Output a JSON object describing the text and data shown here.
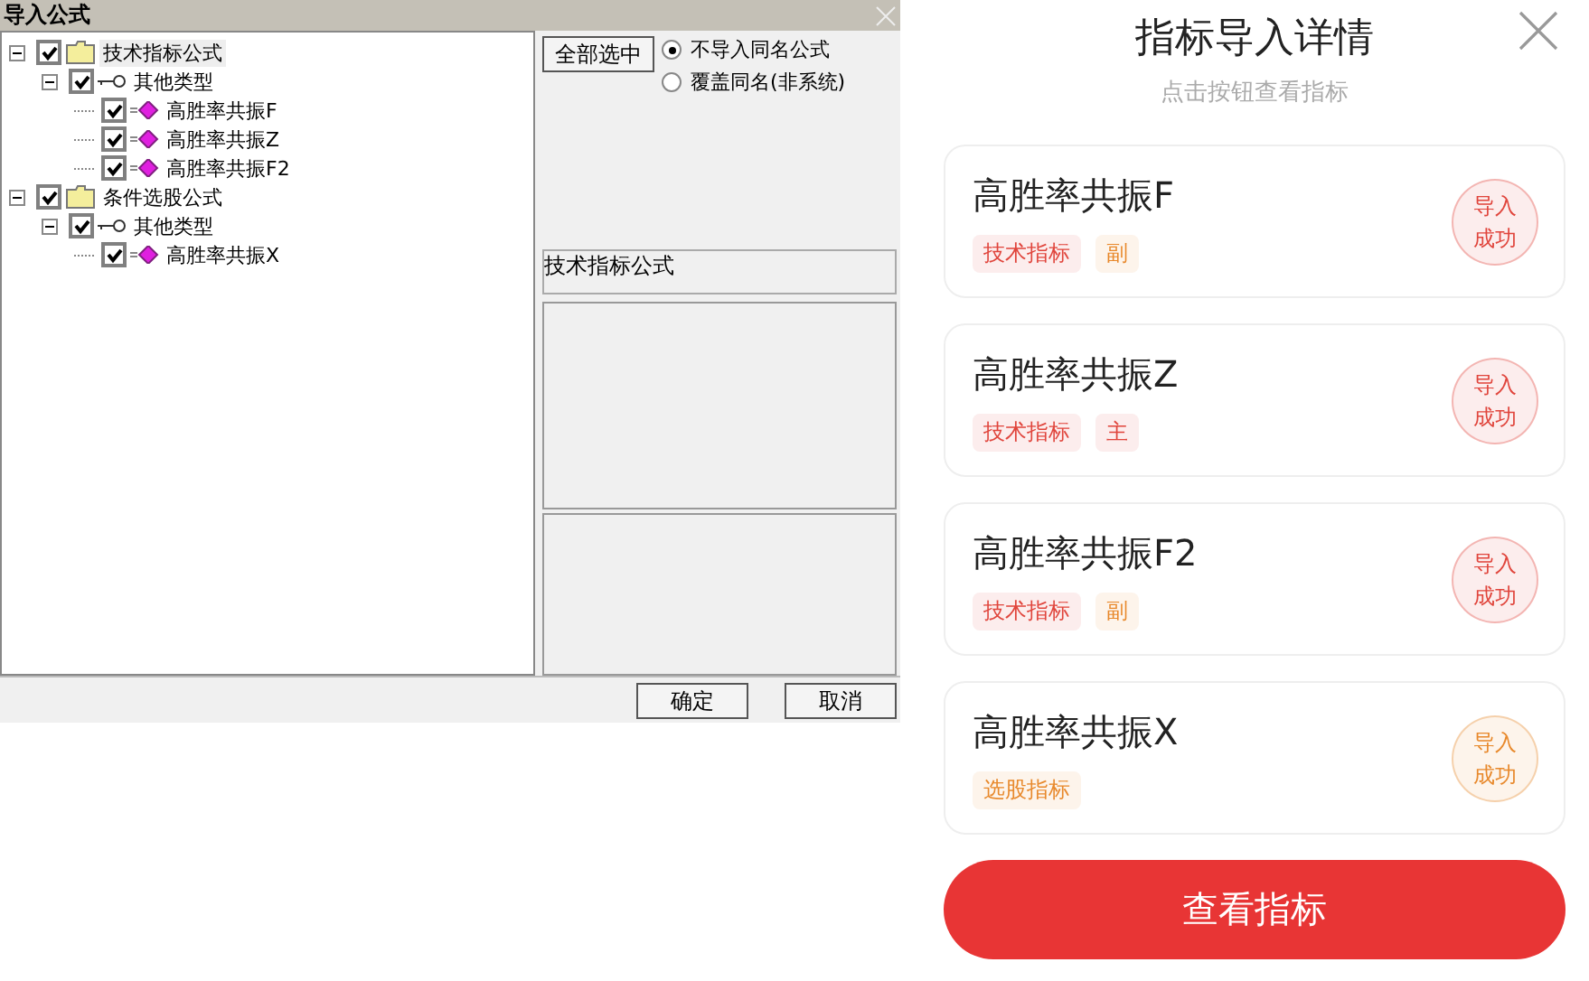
{
  "dialog": {
    "title": "导入公式",
    "tree": [
      {
        "kind": "folder",
        "label": "技术指标公式",
        "checked": true,
        "expanded": true,
        "selected": true,
        "children": [
          {
            "kind": "key",
            "label": "其他类型",
            "checked": true,
            "expanded": true,
            "selected": false,
            "children": [
              {
                "kind": "formula",
                "label": "高胜率共振F",
                "checked": true,
                "selected": false
              },
              {
                "kind": "formula",
                "label": "高胜率共振Z",
                "checked": true,
                "selected": false
              },
              {
                "kind": "formula",
                "label": "高胜率共振F2",
                "checked": true,
                "selected": false
              }
            ]
          }
        ]
      },
      {
        "kind": "folder",
        "label": "条件选股公式",
        "checked": true,
        "expanded": true,
        "selected": false,
        "children": [
          {
            "kind": "key",
            "label": "其他类型",
            "checked": true,
            "expanded": true,
            "selected": false,
            "children": [
              {
                "kind": "formula",
                "label": "高胜率共振X",
                "checked": true,
                "selected": false
              }
            ]
          }
        ]
      }
    ],
    "select_all_button": "全部选中",
    "radios": [
      {
        "label": "不导入同名公式",
        "selected": true
      },
      {
        "label": "覆盖同名(非系统)",
        "selected": false
      }
    ],
    "category_field": "技术指标公式",
    "buttons": [
      "确定",
      "取消"
    ]
  },
  "panel": {
    "title": "指标导入详情",
    "subtitle": "点击按钮查看指标",
    "items": [
      {
        "name": "高胜率共振F",
        "tags": [
          {
            "label": "技术指标",
            "color": "#e0453c"
          },
          {
            "label": "副",
            "color": "#e8892c"
          }
        ],
        "status": "导入成功",
        "color": "#e0453c"
      },
      {
        "name": "高胜率共振Z",
        "tags": [
          {
            "label": "技术指标",
            "color": "#e0453c"
          },
          {
            "label": "主",
            "color": "#e0453c"
          }
        ],
        "status": "导入成功",
        "color": "#e0453c"
      },
      {
        "name": "高胜率共振F2",
        "tags": [
          {
            "label": "技术指标",
            "color": "#e0453c"
          },
          {
            "label": "副",
            "color": "#e8892c"
          }
        ],
        "status": "导入成功",
        "color": "#e0453c"
      },
      {
        "name": "高胜率共振X",
        "tags": [
          {
            "label": "选股指标",
            "color": "#e8892c"
          }
        ],
        "status": "导入成功",
        "color": "#e8892c"
      }
    ],
    "button": "查看指标"
  }
}
